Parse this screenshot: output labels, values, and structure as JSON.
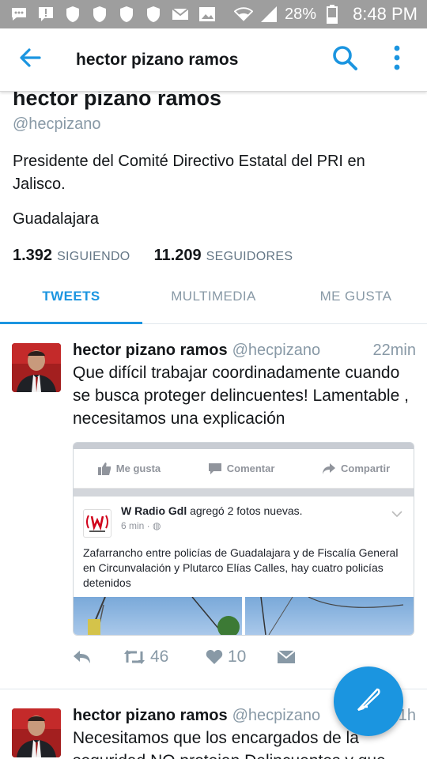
{
  "status_bar": {
    "battery": "28%",
    "time": "8:48 PM",
    "icons": [
      "chat-icon",
      "alert-icon",
      "shield-icon",
      "shield-icon",
      "shield-icon",
      "shield-icon",
      "mail-icon",
      "image-icon",
      "wifi-icon",
      "signal-icon",
      "battery-icon"
    ]
  },
  "app_bar": {
    "title": "hector pizano ramos",
    "icons": [
      "back-arrow-icon",
      "search-icon",
      "more-vertical-icon"
    ]
  },
  "profile": {
    "name": "hector pizano ramos",
    "handle": "@hecpizano",
    "bio": "Presidente del Comité Directivo Estatal del PRI en Jalisco.",
    "location": "Guadalajara",
    "following_count": "1.392",
    "following_label": "SIGUIENDO",
    "followers_count": "11.209",
    "followers_label": "SEGUIDORES"
  },
  "tabs": [
    {
      "label": "TWEETS",
      "active": true
    },
    {
      "label": "MULTIMEDIA",
      "active": false
    },
    {
      "label": "ME GUSTA",
      "active": false
    }
  ],
  "tweets": [
    {
      "name": "hector pizano ramos",
      "handle": "@hecpizano",
      "time": "22min",
      "text": "Que difícil trabajar coordinadamente cuando se busca proteger delincuentes! Lamentable , necesitamos una explicación",
      "embed": {
        "actions": [
          "Me gusta",
          "Comentar",
          "Compartir"
        ],
        "page_name": "W Radio Gdl",
        "page_action": " agregó 2 fotos nuevas.",
        "meta": "6 min ·",
        "text": "Zafarrancho entre policías de Guadalajara y de Fiscalía General en Circunvalación y Plutarco Elías Calles, hay cuatro policías detenidos"
      },
      "retweets": "46",
      "likes": "10"
    },
    {
      "name": "hector pizano ramos",
      "handle": "@hecpizano",
      "time": "1h",
      "text": "Necesitamos que los encargados de la seguridad NO protejan Delincuentes y que"
    }
  ],
  "colors": {
    "accent": "#1b95e0",
    "status_bar": "#9e9e9e",
    "secondary_text": "#8899a6"
  }
}
